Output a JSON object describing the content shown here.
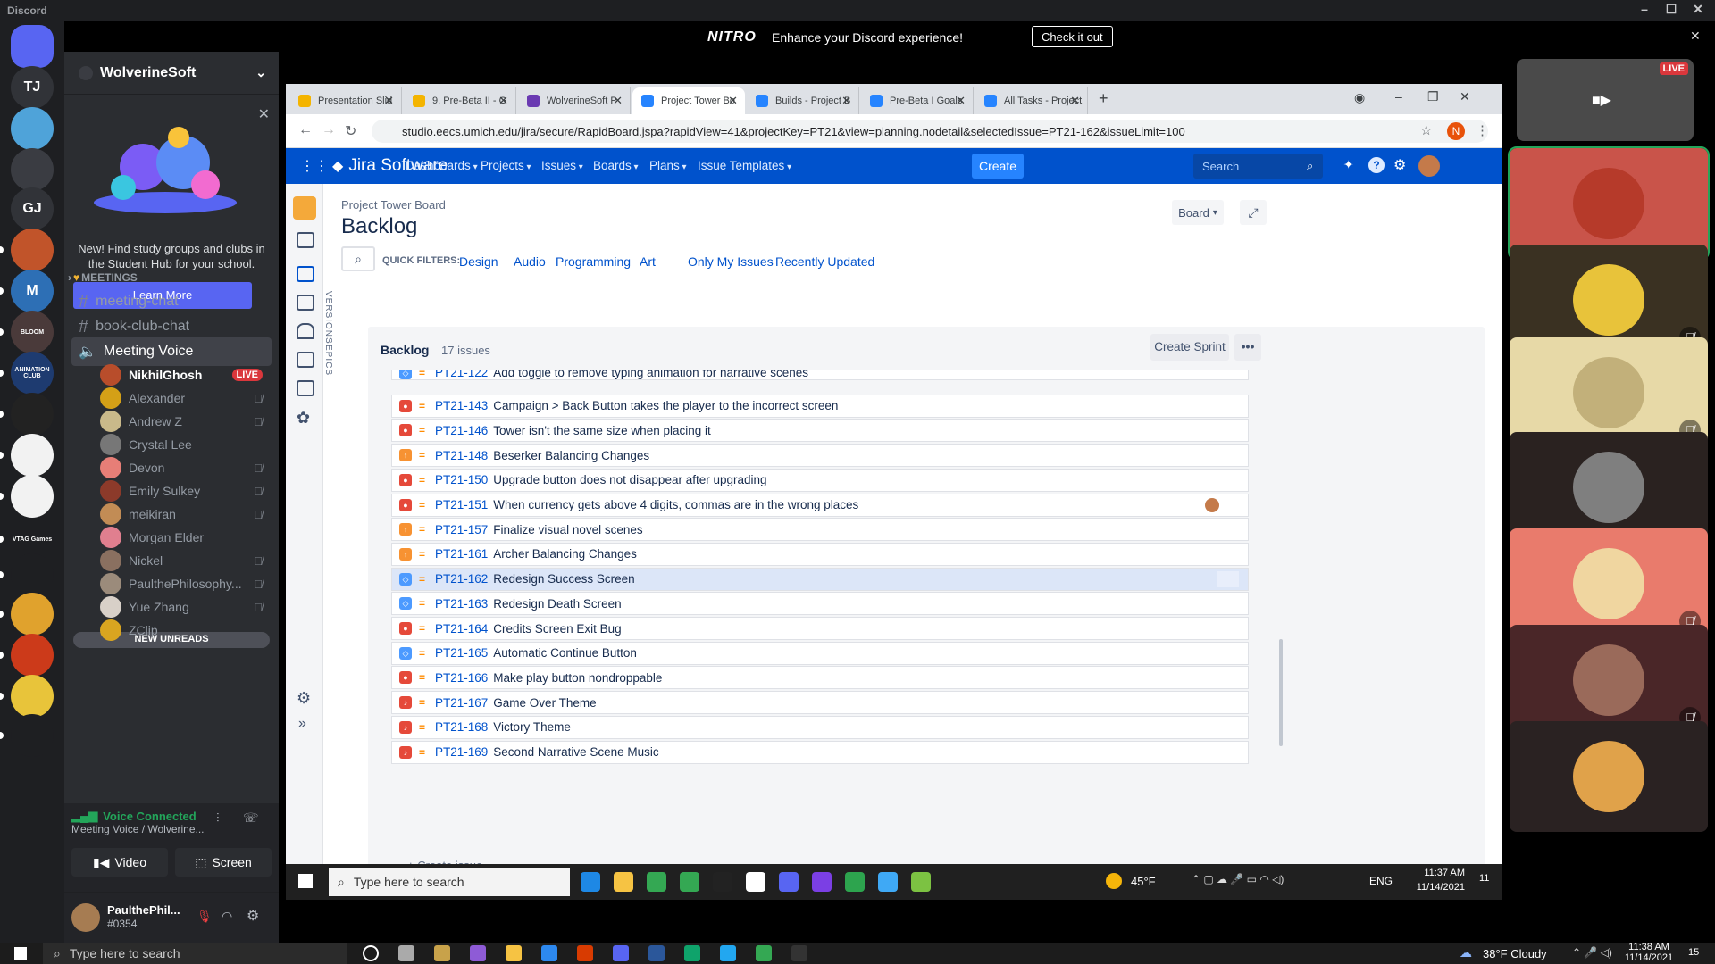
{
  "app": {
    "title": "Discord"
  },
  "window_controls": {
    "minimize": "–",
    "maximize": "☐",
    "close": "✕"
  },
  "nitro": {
    "logo": "NITRO",
    "message": "Enhance your Discord experience!",
    "button": "Check it out",
    "close": "✕"
  },
  "servers": [
    {
      "label": "",
      "color": "#5865f2",
      "icon": "discord-home-icon"
    },
    {
      "label": "TJ",
      "color": "#313338"
    },
    {
      "label": "",
      "color": "#4fa3d9",
      "icon": "server-mascot-icon"
    },
    {
      "label": "",
      "color": "#3a3c42",
      "icon": "gamepad-icon"
    },
    {
      "label": "GJ",
      "color": "#313338"
    },
    {
      "label": "",
      "color": "#c1542a"
    },
    {
      "label": "M",
      "color": "#2d6fb5"
    },
    {
      "label": "BLOOM",
      "color": "#4a3a3a"
    },
    {
      "label": "ANIMATION CLUB",
      "color": "#1e3b70"
    },
    {
      "label": "",
      "color": "#222"
    },
    {
      "label": "",
      "color": "#f2f2f2"
    },
    {
      "label": "",
      "color": "#f2f2f2"
    },
    {
      "label": "VTAG Games",
      "color": "#1e1f22"
    },
    {
      "label": "",
      "color": "#1e1f22"
    },
    {
      "label": "",
      "color": "#e0a22d"
    },
    {
      "label": "",
      "color": "#cc3a1a"
    },
    {
      "label": "",
      "color": "#e8c43a"
    },
    {
      "label": "",
      "color": "#1e1f22"
    }
  ],
  "guild": {
    "name": "WolverineSoft"
  },
  "hub_promo": {
    "text": "New! Find study groups and clubs in the Student Hub for your school.",
    "button": "Learn More"
  },
  "category": {
    "name": "MEETINGS"
  },
  "channels": [
    {
      "name": "meeting-chat",
      "type": "text"
    },
    {
      "name": "book-club-chat",
      "type": "text"
    },
    {
      "name": "Meeting Voice",
      "type": "voice"
    }
  ],
  "voice_members": [
    {
      "name": "NikhilGhosh",
      "live": "LIVE",
      "muted": false,
      "color": "#b84d2b"
    },
    {
      "name": "Alexander",
      "muted": true,
      "color": "#d4a017"
    },
    {
      "name": "Andrew Z",
      "muted": true,
      "color": "#c9b98a"
    },
    {
      "name": "Crystal Lee",
      "muted": false,
      "color": "#777"
    },
    {
      "name": "Devon",
      "muted": true,
      "color": "#e77e77"
    },
    {
      "name": "Emily Sulkey",
      "muted": true,
      "color": "#8c3a2a"
    },
    {
      "name": "meikiran",
      "muted": true,
      "color": "#c28c55"
    },
    {
      "name": "Morgan Elder",
      "muted": false,
      "color": "#e07f8f"
    },
    {
      "name": "Nickel",
      "muted": true,
      "color": "#8a7060"
    },
    {
      "name": "PaulthePhilosophy...",
      "muted": true,
      "color": "#9b8b7b"
    },
    {
      "name": "Yue Zhang",
      "muted": true,
      "color": "#d8d0c8"
    },
    {
      "name": "ZClip",
      "muted": false,
      "color": "#d9a520"
    }
  ],
  "new_unreads": "NEW UNREADS",
  "voice": {
    "status": "Voice Connected",
    "channel": "Meeting Voice / Wolverine...",
    "video": "Video",
    "screen": "Screen"
  },
  "user": {
    "name": "PaulthePhil...",
    "tag": "#0354"
  },
  "browser": {
    "tabs": [
      {
        "title": "Presentation Slid",
        "color": "#f4b400"
      },
      {
        "title": "9. Pre-Beta II - G",
        "color": "#f4b400"
      },
      {
        "title": "WolverineSoft P",
        "color": "#6a3ab2"
      },
      {
        "title": "Project Tower Bo",
        "color": "#2684ff",
        "active": true
      },
      {
        "title": "Builds - Project B",
        "color": "#2684ff"
      },
      {
        "title": "Pre-Beta I Goals",
        "color": "#2684ff"
      },
      {
        "title": "All Tasks - Project",
        "color": "#2684ff"
      }
    ],
    "url": "studio.eecs.umich.edu/jira/secure/RapidBoard.jspa?rapidView=41&projectKey=PT21&view=planning.nodetail&selectedIssue=PT21-162&issueLimit=100",
    "profile": "N"
  },
  "jira": {
    "logo": "Jira Software",
    "menu": [
      "Dashboards",
      "Projects",
      "Issues",
      "Boards",
      "Plans",
      "Issue Templates"
    ],
    "create": "Create",
    "search_placeholder": "Search",
    "board_name": "Project Tower Board",
    "page_title": "Backlog",
    "board_button": "Board",
    "quick_filters_label": "QUICK FILTERS:",
    "quick_filters": [
      "Design",
      "Audio",
      "Programming",
      "Art",
      "Only My Issues",
      "Recently Updated"
    ],
    "versions": "VERSIONS",
    "epics": "EPICS",
    "backlog_label": "Backlog",
    "issue_count": "17 issues",
    "create_sprint": "Create Sprint",
    "create_issue": "+ Create issue",
    "issues": [
      {
        "key": "PT21-122",
        "summary": "Add toggle to remove typing animation for narrative scenes",
        "type": "story",
        "color": "#4c9aff"
      },
      {
        "key": "PT21-143",
        "summary": "Campaign > Back Button takes the player to the incorrect screen",
        "type": "bug",
        "color": "#e5493a"
      },
      {
        "key": "PT21-146",
        "summary": "Tower isn't the same size when placing it",
        "type": "bug",
        "color": "#e5493a"
      },
      {
        "key": "PT21-148",
        "summary": "Beserker Balancing Changes",
        "type": "improvement",
        "color": "#f79232"
      },
      {
        "key": "PT21-150",
        "summary": "Upgrade button does not disappear after upgrading",
        "type": "bug",
        "color": "#e5493a"
      },
      {
        "key": "PT21-151",
        "summary": "When currency gets above 4 digits, commas are in the wrong places",
        "type": "bug",
        "color": "#e5493a",
        "assignee": true
      },
      {
        "key": "PT21-157",
        "summary": "Finalize visual novel scenes",
        "type": "improvement",
        "color": "#f79232"
      },
      {
        "key": "PT21-161",
        "summary": "Archer Balancing Changes",
        "type": "improvement",
        "color": "#f79232"
      },
      {
        "key": "PT21-162",
        "summary": "Redesign Success Screen",
        "type": "story",
        "color": "#4c9aff",
        "selected": true
      },
      {
        "key": "PT21-163",
        "summary": "Redesign Death Screen",
        "type": "story",
        "color": "#4c9aff"
      },
      {
        "key": "PT21-164",
        "summary": "Credits Screen Exit Bug",
        "type": "bug",
        "color": "#e5493a"
      },
      {
        "key": "PT21-165",
        "summary": "Automatic Continue Button",
        "type": "story",
        "color": "#4c9aff"
      },
      {
        "key": "PT21-166",
        "summary": "Make play button nondroppable",
        "type": "bug",
        "color": "#e5493a"
      },
      {
        "key": "PT21-167",
        "summary": "Game Over Theme",
        "type": "audio",
        "color": "#e5493a"
      },
      {
        "key": "PT21-168",
        "summary": "Victory Theme",
        "type": "audio",
        "color": "#e5493a"
      },
      {
        "key": "PT21-169",
        "summary": "Second Narrative Scene Music",
        "type": "audio",
        "color": "#e5493a"
      }
    ]
  },
  "inner_taskbar": {
    "search": "Type here to search",
    "weather": "45°F",
    "lang": "ENG",
    "time": "11:37 AM",
    "date": "11/14/2021",
    "notif": "11"
  },
  "participants": [
    {
      "bg": "#4a4a4a",
      "live": "LIVE",
      "kind": "stream"
    },
    {
      "bg": "#c9544a",
      "avatar": "#b63a2a",
      "highlight": true
    },
    {
      "bg": "#3a3122",
      "avatar": "#e8c33a",
      "muted": true
    },
    {
      "bg": "#e7d9a7",
      "avatar": "#c2b07a",
      "muted": true
    },
    {
      "bg": "#2a2220",
      "avatar": "#7f7f7f"
    },
    {
      "bg": "#e97b6c",
      "avatar": "#f0d6a0",
      "muted": true
    },
    {
      "bg": "#4a2628",
      "avatar": "#9a6a5a",
      "muted": true
    },
    {
      "bg": "#2a2222",
      "avatar": "#e0a24a"
    }
  ],
  "taskbar": {
    "search": "Type here to search",
    "weather": "38°F Cloudy",
    "time": "11:38 AM",
    "date": "11/14/2021",
    "notif": "15"
  }
}
